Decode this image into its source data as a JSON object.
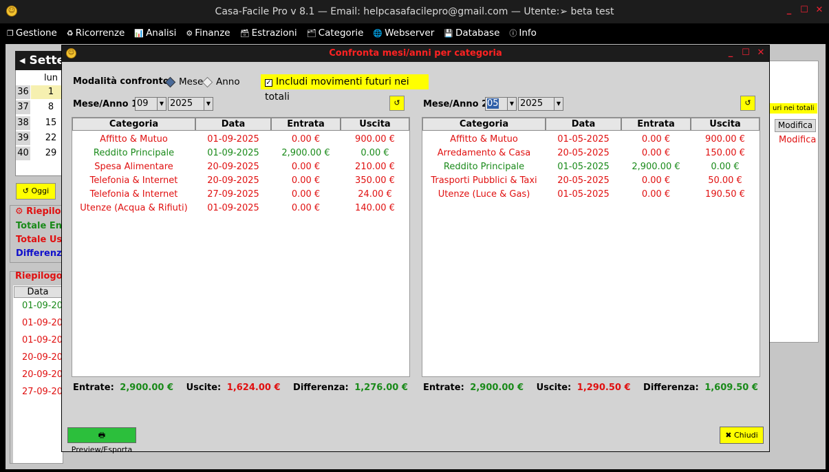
{
  "window": {
    "title": "Casa-Facile Pro v 8.1  — Email: helpcasafacilepro@gmail.com —  Utente:➢ beta test",
    "icon": "smiley-icon",
    "controls": [
      "_",
      "☐",
      "✕"
    ]
  },
  "menu": [
    {
      "icon": "❒",
      "label": "Gestione"
    },
    {
      "icon": "♻",
      "label": "Ricorrenze"
    },
    {
      "icon": "📊",
      "label": "Analisi"
    },
    {
      "icon": "⚙",
      "label": "Finanze"
    },
    {
      "icon": "🗃",
      "label": "Estrazioni"
    },
    {
      "icon": "🗂",
      "label": "Categorie"
    },
    {
      "icon": "🌐",
      "label": "Webserver"
    },
    {
      "icon": "💾",
      "label": "Database"
    },
    {
      "icon": "ⓘ",
      "label": "Info"
    }
  ],
  "background": {
    "calendar_title": "Sette",
    "weekday": "lun",
    "weeks": [
      {
        "wk": "36",
        "day": "1"
      },
      {
        "wk": "37",
        "day": "8"
      },
      {
        "wk": "38",
        "day": "15"
      },
      {
        "wk": "39",
        "day": "22"
      },
      {
        "wk": "40",
        "day": "29"
      }
    ],
    "oggi": "↺ Oggi",
    "riepilogo1": "⚙ Riepilogo",
    "totale_entrate": "Totale Entr",
    "totale_uscite": "Totale Usc",
    "differenza": "Differenza",
    "riepilogo2": "Riepilogo",
    "data_header": "Data",
    "dates": [
      "01-09-202",
      "01-09-202",
      "01-09-202",
      "20-09-202",
      "20-09-202",
      "27-09-202"
    ],
    "right_header": "Modifica",
    "right_cell": "Modifica",
    "right_note": "uri nei totali"
  },
  "dialog": {
    "title": "Confronta mesi/anni per categoria",
    "mode_label": "Modalità confronto:",
    "mode_mese": "Mese",
    "mode_anno": "Anno",
    "futuri_label": "Includi movimenti futuri nei totali",
    "futuri_checked": "✓",
    "headers": [
      "Categoria",
      "Data",
      "Entrata",
      "Uscita"
    ],
    "left": {
      "label": "Mese/Anno 1",
      "month": "09",
      "year": "2025",
      "rows": [
        {
          "cat": "Affitto & Mutuo",
          "data": "01-09-2025",
          "entrata": "0.00 €",
          "uscita": "900.00 €",
          "color": "red"
        },
        {
          "cat": "Reddito Principale",
          "data": "01-09-2025",
          "entrata": "2,900.00 €",
          "uscita": "0.00 €",
          "color": "green"
        },
        {
          "cat": "Spesa Alimentare",
          "data": "20-09-2025",
          "entrata": "0.00 €",
          "uscita": "210.00 €",
          "color": "red"
        },
        {
          "cat": "Telefonia & Internet",
          "data": "20-09-2025",
          "entrata": "0.00 €",
          "uscita": "350.00 €",
          "color": "red"
        },
        {
          "cat": "Telefonia & Internet",
          "data": "27-09-2025",
          "entrata": "0.00 €",
          "uscita": "24.00 €",
          "color": "red"
        },
        {
          "cat": "Utenze (Acqua & Rifiuti)",
          "data": "01-09-2025",
          "entrata": "0.00 €",
          "uscita": "140.00 €",
          "color": "red"
        }
      ],
      "totals": {
        "entrate_label": "Entrate:",
        "entrate": "2,900.00 €",
        "uscite_label": "Uscite:",
        "uscite": "1,624.00 €",
        "diff_label": "Differenza:",
        "diff": "1,276.00 €"
      }
    },
    "right": {
      "label": "Mese/Anno 2",
      "month": "05",
      "year": "2025",
      "rows": [
        {
          "cat": "Affitto & Mutuo",
          "data": "01-05-2025",
          "entrata": "0.00 €",
          "uscita": "900.00 €",
          "color": "red"
        },
        {
          "cat": "Arredamento & Casa",
          "data": "20-05-2025",
          "entrata": "0.00 €",
          "uscita": "150.00 €",
          "color": "red"
        },
        {
          "cat": "Reddito Principale",
          "data": "01-05-2025",
          "entrata": "2,900.00 €",
          "uscita": "0.00 €",
          "color": "green"
        },
        {
          "cat": "Trasporti Pubblici & Taxi",
          "data": "20-05-2025",
          "entrata": "0.00 €",
          "uscita": "50.00 €",
          "color": "red"
        },
        {
          "cat": "Utenze (Luce & Gas)",
          "data": "01-05-2025",
          "entrata": "0.00 €",
          "uscita": "190.50 €",
          "color": "red"
        }
      ],
      "totals": {
        "entrate_label": "Entrate:",
        "entrate": "2,900.00 €",
        "uscite_label": "Uscite:",
        "uscite": "1,290.50 €",
        "diff_label": "Differenza:",
        "diff": "1,609.50 €"
      }
    },
    "refresh_icon": "↺",
    "preview_button": "🖶 Preview/Esporta",
    "close_button": "✖ Chiudi"
  }
}
